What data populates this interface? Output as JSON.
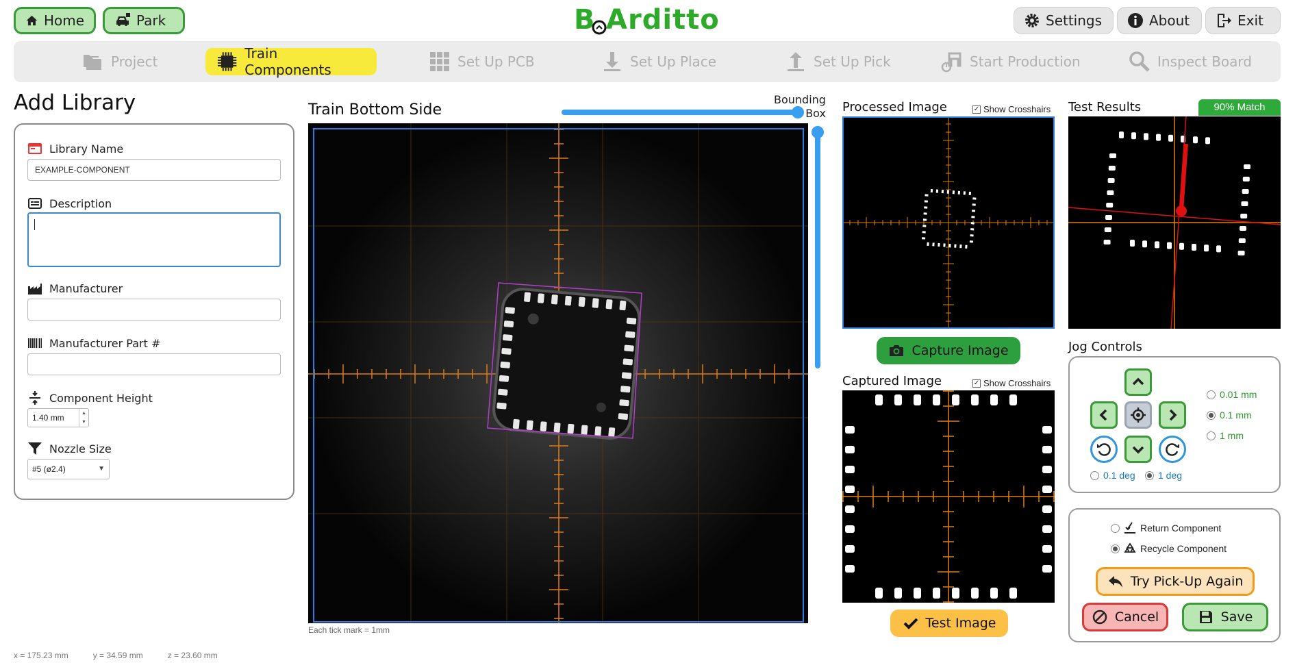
{
  "topbar": {
    "home_label": "Home",
    "park_label": "Park",
    "settings_label": "Settings",
    "about_label": "About",
    "exit_label": "Exit",
    "logo_text": "BoArditto"
  },
  "stepper": {
    "steps": [
      {
        "label": "Project",
        "icon": "folders-icon"
      },
      {
        "label": "Train Components",
        "icon": "chip-icon"
      },
      {
        "label": "Set Up PCB",
        "icon": "grid-icon"
      },
      {
        "label": "Set Up Place",
        "icon": "download-icon"
      },
      {
        "label": "Set Up Pick",
        "icon": "upload-icon"
      },
      {
        "label": "Start Production",
        "icon": "machine-icon"
      },
      {
        "label": "Inspect Board",
        "icon": "magnifier-icon"
      }
    ],
    "active_index": 1
  },
  "library": {
    "title": "Add Library",
    "name_label": "Library Name",
    "name_value": "EXAMPLE-COMPONENT",
    "description_label": "Description",
    "description_value": "",
    "manufacturer_label": "Manufacturer",
    "manufacturer_value": "",
    "part_label": "Manufacturer Part #",
    "part_value": "",
    "height_label": "Component Height",
    "height_value": "1.40 mm",
    "nozzle_label": "Nozzle Size",
    "nozzle_value": "#5  (ø2.4)"
  },
  "camera": {
    "title": "Train Bottom Side",
    "bbox_label_1": "Bounding",
    "bbox_label_2": "Box",
    "tick_note": "Each tick mark = 1mm",
    "crosshair_color": "#e07d10",
    "frame_color": "#2a7ee0",
    "bbox_color": "#b040c8"
  },
  "processed": {
    "title": "Processed Image",
    "crosshairs_label": "Show Crosshairs",
    "crosshairs_checked": true,
    "capture_label": "Capture Image"
  },
  "captured": {
    "title": "Captured Image",
    "crosshairs_label": "Show Crosshairs",
    "crosshairs_checked": true,
    "test_label": "Test Image"
  },
  "results": {
    "title": "Test Results",
    "match_label": "90% Match"
  },
  "jog": {
    "title": "Jog Controls",
    "step_options": [
      "0.01 mm",
      "0.1 mm",
      "1 mm"
    ],
    "step_selected": 1,
    "rot_options": [
      "0.1 deg",
      "1 deg"
    ],
    "rot_selected": 1
  },
  "actions": {
    "return_label": "Return Component",
    "recycle_label": "Recycle Component",
    "recycle_selected": true,
    "retry_label": "Try Pick-Up Again",
    "cancel_label": "Cancel",
    "save_label": "Save"
  },
  "status": {
    "x": "x = 175.23 mm",
    "y": "y = 34.59 mm",
    "z": "z = 23.60 mm"
  }
}
